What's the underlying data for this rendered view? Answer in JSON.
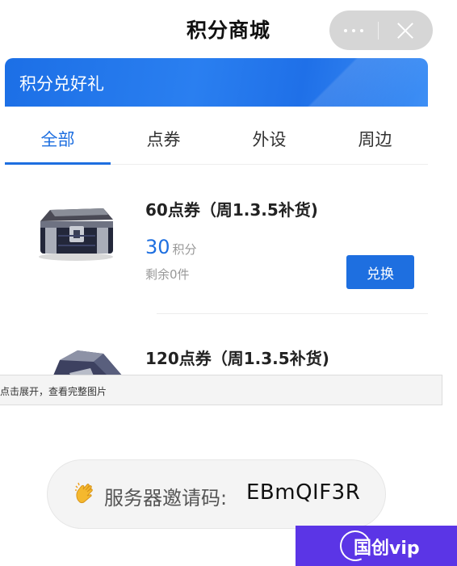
{
  "page": {
    "title": "积分商城"
  },
  "capsule": {
    "more_icon": "more-dots-icon",
    "close_icon": "close-icon"
  },
  "banner": {
    "title": "积分兑好礼",
    "color": "#1e6fe0"
  },
  "tabs": [
    {
      "label": "全部",
      "active": true
    },
    {
      "label": "点券",
      "active": false
    },
    {
      "label": "外设",
      "active": false
    },
    {
      "label": "周边",
      "active": false
    }
  ],
  "items": [
    {
      "name": "60点券（周1.3.5补货)",
      "points": "30",
      "points_unit": "积分",
      "stock": "剩余0件",
      "button": "兑换",
      "image_icon": "treasure-chest-icon"
    },
    {
      "name": "120点券（周1.3.5补货)",
      "image_icon": "treasure-chest-icon"
    }
  ],
  "expand_hint": "点击展开，查看完整图片",
  "invite": {
    "emoji_icon": "waving-hand-icon",
    "label": "服务器邀请码:",
    "code": "EBmQIF3R"
  },
  "watermark": {
    "text": "国创vip",
    "color": "#5b35e6"
  }
}
